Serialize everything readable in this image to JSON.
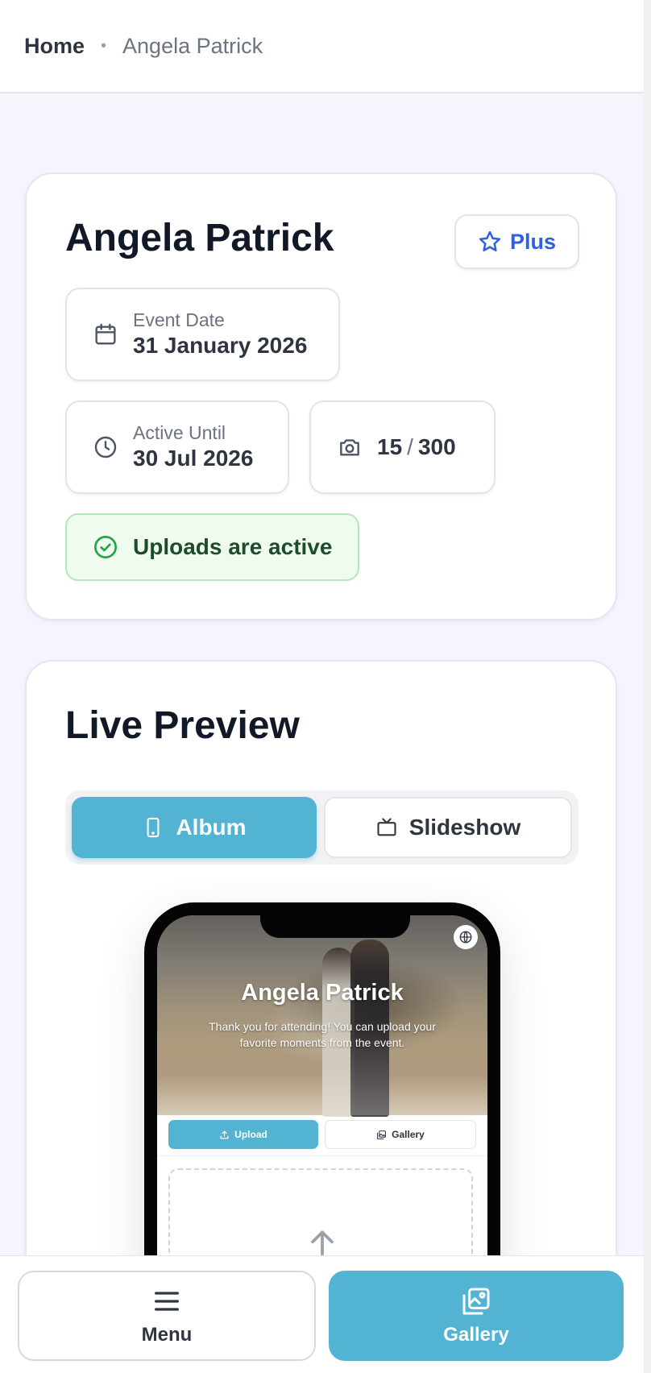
{
  "breadcrumb": {
    "home": "Home",
    "separator": "•",
    "current": "Angela Patrick"
  },
  "event": {
    "title": "Angela Patrick",
    "plan_badge": "Plus",
    "event_date_label": "Event Date",
    "event_date_value": "31 January 2026",
    "active_until_label": "Active Until",
    "active_until_value": "30 Jul 2026",
    "photos_used": "15",
    "photos_separator": "/",
    "photos_limit": "300",
    "status_text": "Uploads are active"
  },
  "preview": {
    "title": "Live Preview",
    "modes": [
      {
        "label": "Album",
        "icon": "smartphone-icon",
        "active": true
      },
      {
        "label": "Slideshow",
        "icon": "tv-icon",
        "active": false
      }
    ],
    "phone": {
      "hero_title": "Angela Patrick",
      "hero_subtitle": "Thank you for attending! You can upload your favorite moments from the event.",
      "tabs": [
        {
          "label": "Upload",
          "icon": "upload-icon",
          "active": true
        },
        {
          "label": "Gallery",
          "icon": "gallery-icon",
          "active": false
        }
      ]
    }
  },
  "bottom_nav": {
    "menu_label": "Menu",
    "gallery_label": "Gallery"
  },
  "colors": {
    "accent": "#52b3d3",
    "brand_blue": "#2f5fe3",
    "success_bg": "#effbef",
    "success_border": "#b6e6bc",
    "success_icon": "#22a447",
    "page_bg": "#f6f4fd"
  }
}
